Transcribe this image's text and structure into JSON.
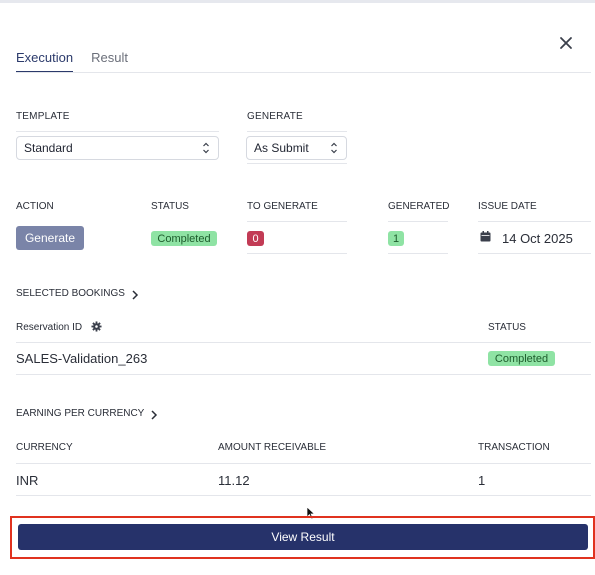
{
  "tabs": [
    {
      "label": "Execution",
      "active": true
    },
    {
      "label": "Result",
      "active": false
    }
  ],
  "template": {
    "label": "TEMPLATE",
    "value": "Standard"
  },
  "generate": {
    "label": "GENERATE",
    "value": "As Submit"
  },
  "summary": {
    "headers": {
      "action": "ACTION",
      "status": "STATUS",
      "to_generate": "TO GENERATE",
      "generated": "GENERATED",
      "issue_date": "ISSUE DATE"
    },
    "action_button": "Generate",
    "status_badge": "Completed",
    "to_generate_value": "0",
    "generated_value": "1",
    "issue_date_value": "14 Oct 2025"
  },
  "selected_bookings": {
    "title": "SELECTED BOOKINGS",
    "columns": [
      "Reservation ID",
      "STATUS"
    ],
    "rows": [
      {
        "reservation_id": "SALES-Validation_263",
        "status": "Completed"
      }
    ]
  },
  "earning_per_currency": {
    "title": "EARNING PER CURRENCY",
    "columns": [
      "CURRENCY",
      "AMOUNT RECEIVABLE",
      "TRANSACTION"
    ],
    "rows": [
      {
        "currency": "INR",
        "amount": "11.12",
        "transaction": "1"
      }
    ]
  },
  "footer": {
    "view_result_label": "View Result"
  },
  "colors": {
    "accent": "#26326a",
    "success_badge": "#8fe3a4",
    "danger_badge": "#c23b55",
    "generate_button": "#7a84a8",
    "highlight_border": "#e0321f"
  },
  "icons": [
    "close-icon",
    "chevron-updown-icon",
    "calendar-icon",
    "chevron-right-icon",
    "gear-icon",
    "mouse-cursor-icon"
  ]
}
